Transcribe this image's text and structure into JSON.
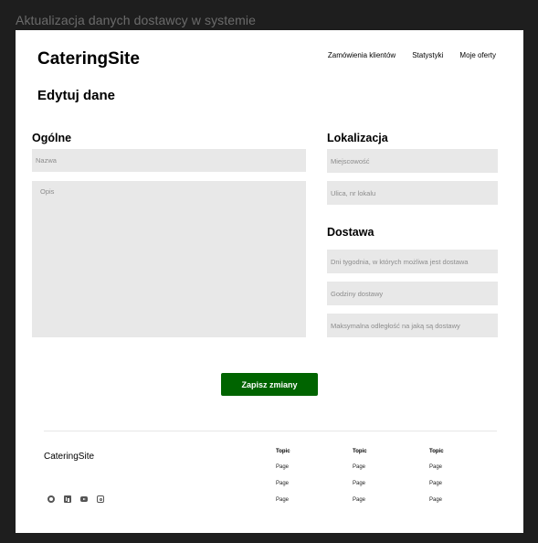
{
  "frame_title": "Aktualizacja danych dostawcy w systemie",
  "header": {
    "logo": "CateringSite",
    "nav": [
      "Zamówienia klientów",
      "Statystyki",
      "Moje oferty"
    ]
  },
  "page_title": "Edytuj dane",
  "general": {
    "title": "Ogólne",
    "name_placeholder": "Nazwa",
    "description_placeholder": "Opis"
  },
  "location": {
    "title": "Lokalizacja",
    "city_placeholder": "Miejscowość",
    "street_placeholder": "Ulica, nr lokalu"
  },
  "delivery": {
    "title": "Dostawa",
    "days_placeholder": "Dni tygodnia, w których możliwa jest dostawa",
    "hours_placeholder": "Godziny dostawy",
    "distance_placeholder": "Maksymalna odległość na jaką są dostawy"
  },
  "save_label": "Zapisz zmiany",
  "footer": {
    "logo": "CateringSite",
    "social_icons": [
      "facebook-icon",
      "linkedin-icon",
      "youtube-icon",
      "instagram-icon"
    ],
    "columns": [
      {
        "topic": "Topic",
        "pages": [
          "Page",
          "Page",
          "Page"
        ]
      },
      {
        "topic": "Topic",
        "pages": [
          "Page",
          "Page",
          "Page"
        ]
      },
      {
        "topic": "Topic",
        "pages": [
          "Page",
          "Page",
          "Page"
        ]
      }
    ]
  },
  "colors": {
    "accent": "#006400",
    "field_bg": "#e8e8e8",
    "frame_bg": "#1e1e1e"
  }
}
